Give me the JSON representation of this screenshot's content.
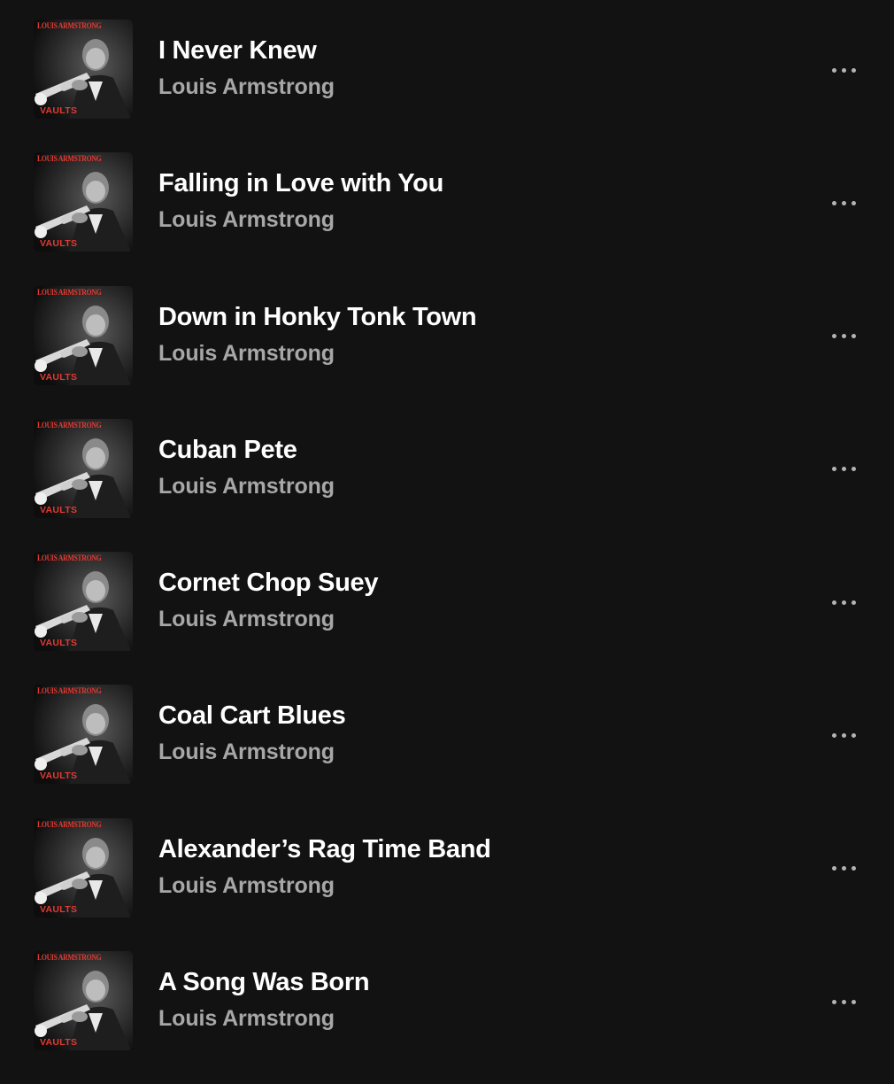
{
  "colors": {
    "background": "#121212",
    "title": "#ffffff",
    "subtitle": "#a7a7a7",
    "cover_accent": "#e33a32"
  },
  "cover_art": {
    "artist_text": "LOUIS ARMSTRONG",
    "label_text": "VAULTS"
  },
  "more_icon": "more-horizontal-icon",
  "tracks": [
    {
      "title": "I Never Knew",
      "artist": "Louis Armstrong"
    },
    {
      "title": "Falling in Love with You",
      "artist": "Louis Armstrong"
    },
    {
      "title": "Down in Honky Tonk Town",
      "artist": "Louis Armstrong"
    },
    {
      "title": "Cuban Pete",
      "artist": "Louis Armstrong"
    },
    {
      "title": "Cornet Chop Suey",
      "artist": "Louis Armstrong"
    },
    {
      "title": "Coal Cart Blues",
      "artist": "Louis Armstrong"
    },
    {
      "title": "Alexander’s Rag Time Band",
      "artist": "Louis Armstrong"
    },
    {
      "title": "A Song Was Born",
      "artist": "Louis Armstrong"
    }
  ]
}
